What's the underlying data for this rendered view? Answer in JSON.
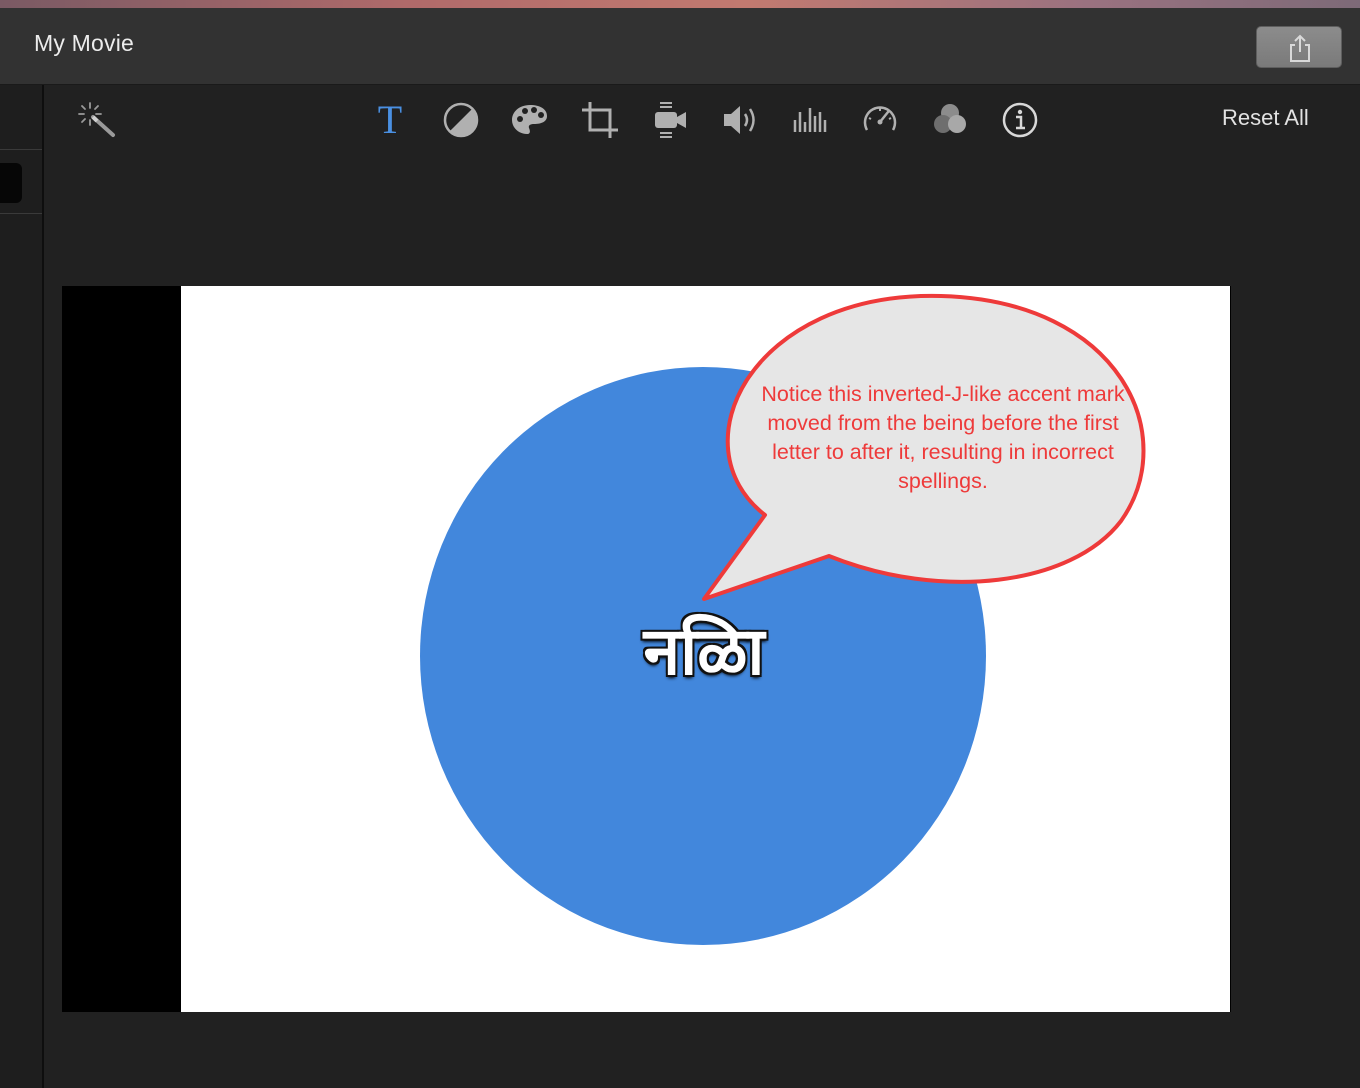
{
  "window": {
    "title": "My Movie"
  },
  "toolbar": {
    "icons": [
      "magic-wand-icon",
      "title-text-icon",
      "color-balance-icon",
      "color-palette-icon",
      "crop-icon",
      "stabilization-camera-icon",
      "volume-icon",
      "equalizer-icon",
      "speed-gauge-icon",
      "filter-circles-icon",
      "info-icon"
    ],
    "title_tool_glyph": "T",
    "reset_label": "Reset All"
  },
  "viewer": {
    "title_text": "नळिा",
    "callout_text": "Notice this inverted-J-like accent mark  moved from the being before the first letter to after it, resulting in incorrect spellings."
  },
  "colors": {
    "accent_blue": "#4a90e2",
    "circle_blue": "#4287dc",
    "callout_red": "#ee3a3a",
    "callout_fill": "#e6e6e6"
  }
}
